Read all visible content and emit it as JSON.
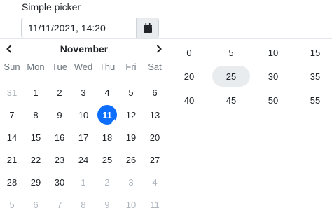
{
  "field": {
    "label": "Simple picker",
    "value": "11/11/2021, 14:20",
    "button_icon": "calendar-icon"
  },
  "calendar": {
    "month": "November",
    "prev_icon": "chevron-left-icon",
    "next_icon": "chevron-right-icon",
    "weekdays": [
      "Sun",
      "Mon",
      "Tue",
      "Wed",
      "Thu",
      "Fri",
      "Sat"
    ],
    "days": [
      {
        "label": "31",
        "muted": true
      },
      {
        "label": "1"
      },
      {
        "label": "2"
      },
      {
        "label": "3"
      },
      {
        "label": "4"
      },
      {
        "label": "5"
      },
      {
        "label": "6"
      },
      {
        "label": "7"
      },
      {
        "label": "8"
      },
      {
        "label": "9"
      },
      {
        "label": "10"
      },
      {
        "label": "11",
        "selected": true
      },
      {
        "label": "12"
      },
      {
        "label": "13"
      },
      {
        "label": "14"
      },
      {
        "label": "15"
      },
      {
        "label": "16"
      },
      {
        "label": "17"
      },
      {
        "label": "18"
      },
      {
        "label": "19"
      },
      {
        "label": "20"
      },
      {
        "label": "21"
      },
      {
        "label": "22"
      },
      {
        "label": "23"
      },
      {
        "label": "24"
      },
      {
        "label": "25"
      },
      {
        "label": "26"
      },
      {
        "label": "27"
      },
      {
        "label": "28"
      },
      {
        "label": "29"
      },
      {
        "label": "30"
      },
      {
        "label": "1",
        "muted": true
      },
      {
        "label": "2",
        "muted": true
      },
      {
        "label": "3",
        "muted": true
      },
      {
        "label": "4",
        "muted": true
      },
      {
        "label": "5",
        "muted": true
      },
      {
        "label": "6",
        "muted": true
      },
      {
        "label": "7",
        "muted": true
      },
      {
        "label": "8",
        "muted": true
      },
      {
        "label": "9",
        "muted": true
      },
      {
        "label": "10",
        "muted": true
      },
      {
        "label": "11",
        "muted": true
      }
    ]
  },
  "minutes": {
    "options": [
      "0",
      "5",
      "10",
      "15",
      "20",
      "25",
      "30",
      "35",
      "40",
      "45",
      "50",
      "55"
    ],
    "selected": "25"
  },
  "colors": {
    "accent": "#0d6efd",
    "selected_minute_bg": "#e9ecef",
    "muted_text": "#adb5bd"
  }
}
